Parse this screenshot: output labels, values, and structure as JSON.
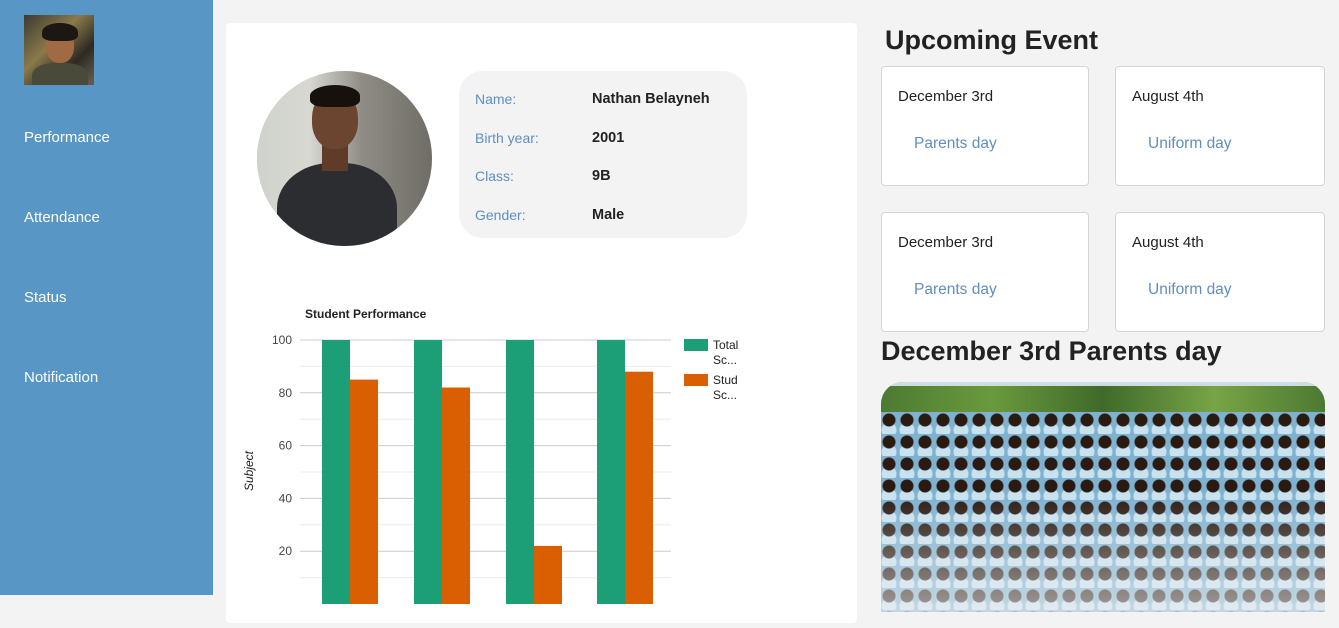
{
  "sidebar": {
    "items": [
      {
        "label": "Performance"
      },
      {
        "label": "Attendance"
      },
      {
        "label": "Status"
      },
      {
        "label": "Notification"
      }
    ]
  },
  "profile": {
    "fields": [
      {
        "key": "Name:",
        "value": "Nathan Belayneh"
      },
      {
        "key": "Birth year:",
        "value": "2001"
      },
      {
        "key": "Class:",
        "value": "9B"
      },
      {
        "key": "Gender:",
        "value": "Male"
      }
    ]
  },
  "chart_data": {
    "type": "bar",
    "title": "Student Performance",
    "xlabel": "",
    "ylabel": "Subject",
    "ylim": [
      0,
      100
    ],
    "yticks": [
      20,
      40,
      60,
      80,
      100
    ],
    "grid": true,
    "legend_position": "right",
    "categories": [
      "",
      "",
      "",
      ""
    ],
    "series": [
      {
        "name": "Total Sc...",
        "color": "#1c9e77",
        "values": [
          100,
          100,
          100,
          100
        ]
      },
      {
        "name": "Stud Sc...",
        "color": "#d95f02",
        "values": [
          85,
          82,
          22,
          88
        ]
      }
    ]
  },
  "events": {
    "title": "Upcoming Event",
    "cards": [
      {
        "date": "December 3rd",
        "name": "Parents day"
      },
      {
        "date": "August 4th",
        "name": "Uniform day"
      },
      {
        "date": "December 3rd",
        "name": "Parents day"
      },
      {
        "date": "August 4th",
        "name": "Uniform day"
      }
    ]
  },
  "featured": {
    "title": "December 3rd Parents day"
  },
  "colors": {
    "sidebar": "#5796c5",
    "accent_text": "#5f8fbf",
    "series_total": "#1c9e77",
    "series_student": "#d95f02"
  }
}
